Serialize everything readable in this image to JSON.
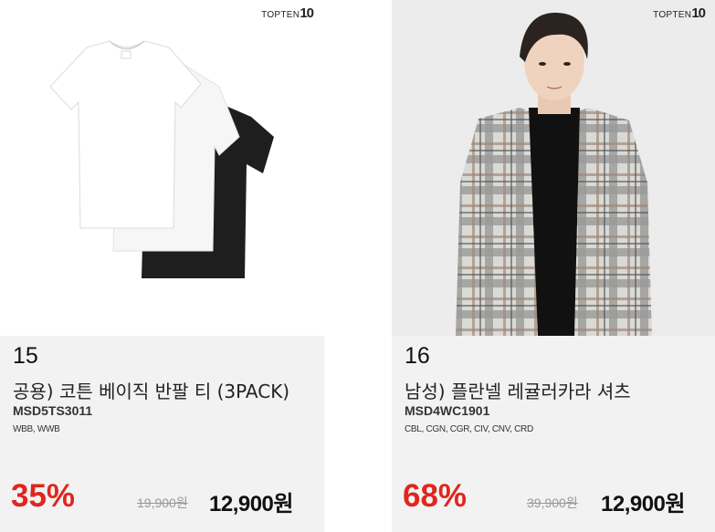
{
  "brand": {
    "name": "TOPTEN",
    "mark": "10"
  },
  "products": [
    {
      "rank": "15",
      "name": "공용) 코튼 베이직 반팔 티 (3PACK)",
      "code": "MSD5TS3011",
      "colors": "WBB, WWB",
      "discount": "35%",
      "original_price": "19,900원",
      "price": "12,900원"
    },
    {
      "rank": "16",
      "name": "남성) 플란넬 레귤러카라 셔츠",
      "code": "MSD4WC1901",
      "colors": "CBL, CGN, CGR, CIV, CNV, CRD",
      "discount": "68%",
      "original_price": "39,900원",
      "price": "12,900원"
    }
  ],
  "colors": {
    "discount": "#e0261d",
    "card_bg": "#f2f2f2",
    "strike": "#999999"
  }
}
